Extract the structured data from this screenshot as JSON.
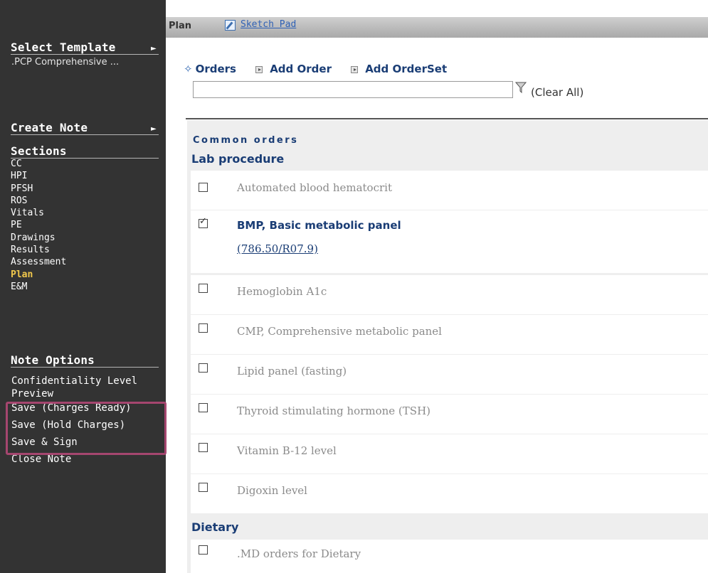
{
  "sidebar": {
    "select_template": "Select Template",
    "template_value": ".PCP Comprehensive ...",
    "create_note": "Create Note",
    "sections_title": "Sections",
    "sections": [
      "CC",
      "HPI",
      "PFSH",
      "ROS",
      "Vitals",
      "PE",
      "Drawings",
      "Results",
      "Assessment",
      "Plan",
      "E&M"
    ],
    "active_section": "Plan",
    "note_options_title": "Note Options",
    "note_options": [
      "Confidentiality Level",
      "Preview",
      "Save (Charges Ready)",
      "Save (Hold Charges)",
      "Save & Sign",
      "Close Note"
    ],
    "highlight_color": "#a5466f"
  },
  "topbar": {
    "section_label": "Plan",
    "sketch_pad_label": "Sketch Pad"
  },
  "orders_bar": {
    "orders_label": "Orders",
    "add_order_label": "Add Order",
    "add_orderset_label": "Add OrderSet",
    "search_value": "",
    "clear_all_label": "(Clear All)"
  },
  "common_orders": {
    "title": "Common orders",
    "lab_group_title": "Lab procedure",
    "lab_items": [
      {
        "label": "Automated blood hematocrit",
        "checked": false
      },
      {
        "label": "BMP, Basic metabolic panel",
        "checked": true,
        "code": "(786.50/R07.9)"
      },
      {
        "label": "Hemoglobin A1c",
        "checked": false
      },
      {
        "label": "CMP, Comprehensive metabolic panel",
        "checked": false
      },
      {
        "label": "Lipid panel (fasting)",
        "checked": false
      },
      {
        "label": "Thyroid stimulating hormone (TSH)",
        "checked": false
      },
      {
        "label": "Vitamin B-12 level",
        "checked": false
      },
      {
        "label": "Digoxin level",
        "checked": false
      }
    ],
    "dietary_group_title": "Dietary",
    "dietary_items": [
      {
        "label": ".MD orders for Dietary",
        "checked": false
      }
    ]
  },
  "colors": {
    "sidebar_bg": "#333333",
    "active_section": "#f2c94c",
    "heading_blue": "#1a3d75",
    "link_blue": "#2f61b5"
  }
}
